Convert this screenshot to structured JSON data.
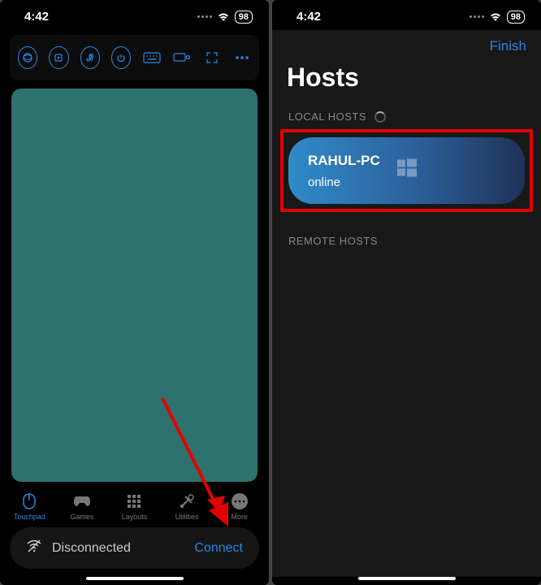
{
  "status": {
    "time": "4:42",
    "battery": "98"
  },
  "phone1": {
    "tabs": {
      "touchpad": "Touchpad",
      "games": "Games",
      "layouts": "Layouts",
      "utilities": "Utilities",
      "more": "More"
    },
    "connection": {
      "status": "Disconnected",
      "action": "Connect"
    }
  },
  "phone2": {
    "finish": "Finish",
    "title": "Hosts",
    "localHeader": "LOCAL HOSTS",
    "remoteHeader": "REMOTE HOSTS",
    "host": {
      "name": "RAHUL-PC",
      "status": "online"
    }
  }
}
